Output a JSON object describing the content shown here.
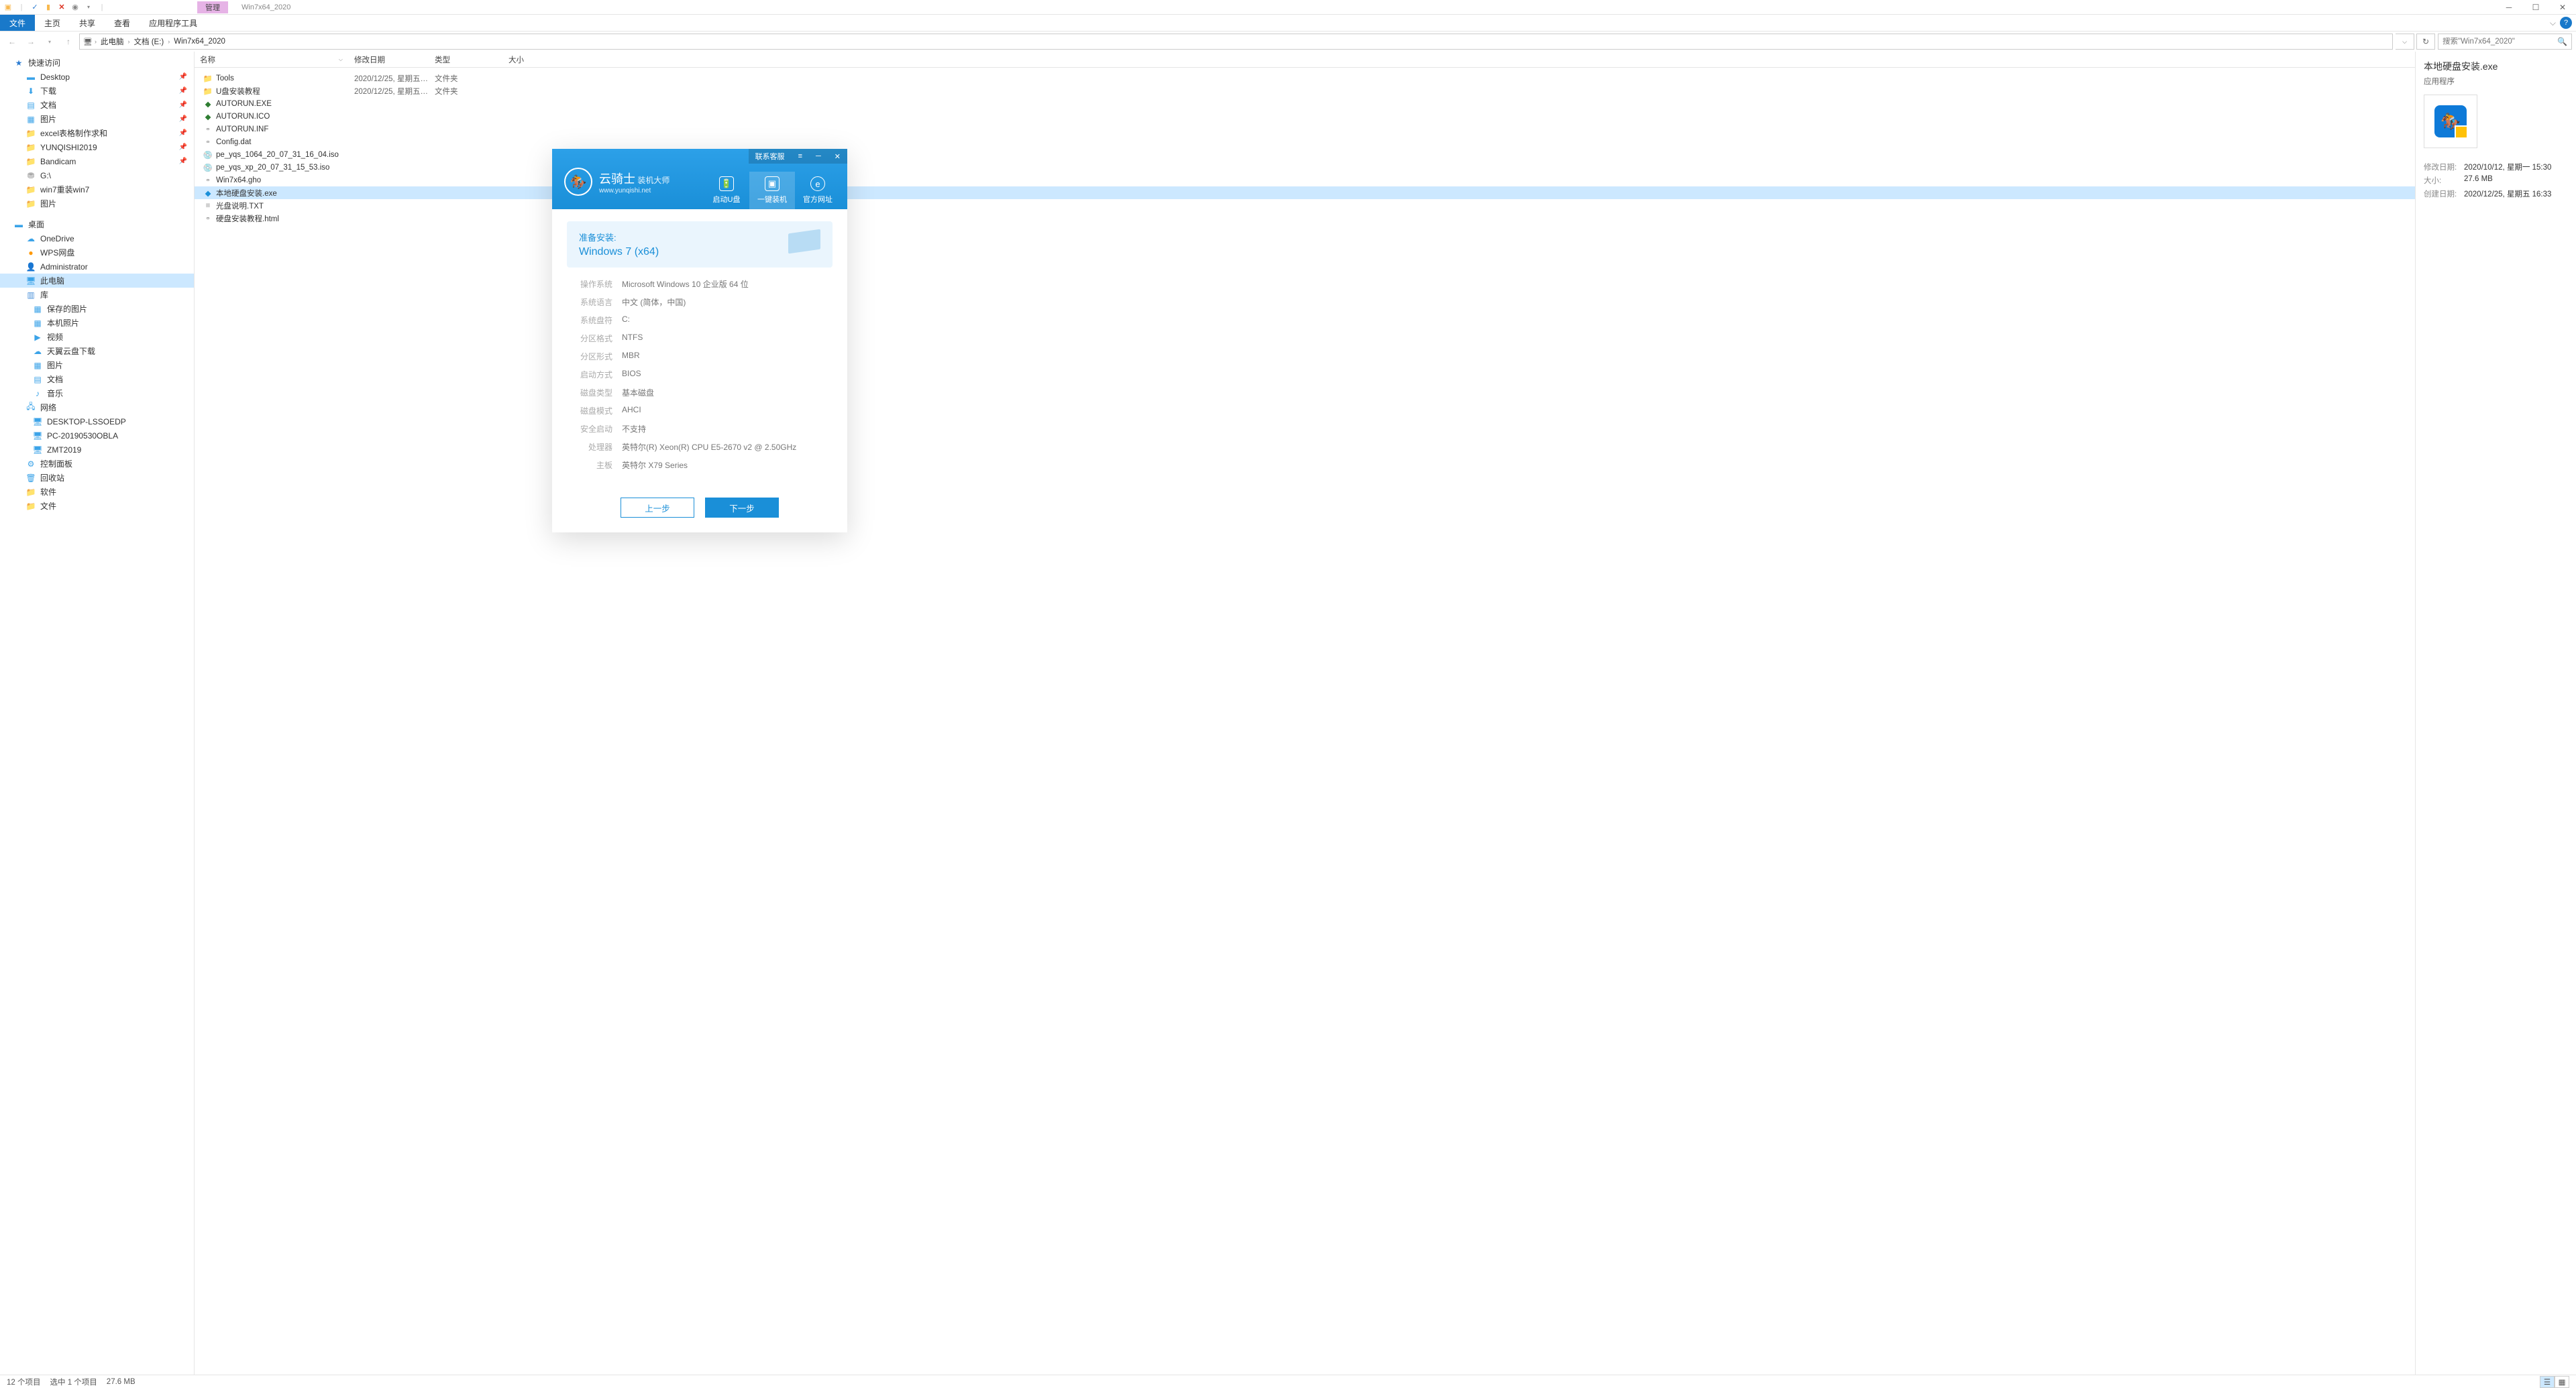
{
  "window": {
    "title": "Win7x64_2020",
    "manage_tab": "管理"
  },
  "ribbon": {
    "file": "文件",
    "home": "主页",
    "share": "共享",
    "view": "查看",
    "apptools": "应用程序工具"
  },
  "breadcrumb": {
    "c1": "此电脑",
    "c2": "文档 (E:)",
    "c3": "Win7x64_2020"
  },
  "search": {
    "placeholder": "搜索\"Win7x64_2020\""
  },
  "nav": {
    "quick": "快速访问",
    "desktop": "Desktop",
    "downloads": "下载",
    "docs": "文档",
    "pics": "图片",
    "excel": "excel表格制作求和",
    "yunqishi": "YUNQISHI2019",
    "bandicam": "Bandicam",
    "g": "G:\\",
    "win7re": "win7重装win7",
    "pics2": "图片",
    "deskhead": "桌面",
    "onedrive": "OneDrive",
    "wps": "WPS网盘",
    "admin": "Administrator",
    "thispc": "此电脑",
    "lib": "库",
    "savedpics": "保存的图片",
    "localphotos": "本机照片",
    "video": "视频",
    "tianyi": "天翼云盘下载",
    "pics3": "图片",
    "docs2": "文档",
    "music": "音乐",
    "network": "网络",
    "pc1": "DESKTOP-LSSOEDP",
    "pc2": "PC-20190530OBLA",
    "pc3": "ZMT2019",
    "ctrlpanel": "控制面板",
    "recycle": "回收站",
    "soft": "软件",
    "files": "文件"
  },
  "columns": {
    "name": "名称",
    "date": "修改日期",
    "type": "类型",
    "size": "大小"
  },
  "files": [
    {
      "name": "Tools",
      "date": "2020/12/25, 星期五 1...",
      "type": "文件夹",
      "icon": "folder"
    },
    {
      "name": "U盘安装教程",
      "date": "2020/12/25, 星期五 1...",
      "type": "文件夹",
      "icon": "folder"
    },
    {
      "name": "AUTORUN.EXE",
      "date": "",
      "type": "",
      "icon": "exe-green"
    },
    {
      "name": "AUTORUN.ICO",
      "date": "",
      "type": "",
      "icon": "exe-green"
    },
    {
      "name": "AUTORUN.INF",
      "date": "",
      "type": "",
      "icon": "file"
    },
    {
      "name": "Config.dat",
      "date": "",
      "type": "",
      "icon": "file"
    },
    {
      "name": "pe_yqs_1064_20_07_31_16_04.iso",
      "date": "",
      "type": "",
      "icon": "disc"
    },
    {
      "name": "pe_yqs_xp_20_07_31_15_53.iso",
      "date": "",
      "type": "",
      "icon": "disc"
    },
    {
      "name": "Win7x64.gho",
      "date": "",
      "type": "",
      "icon": "file"
    },
    {
      "name": "本地硬盘安装.exe",
      "date": "",
      "type": "",
      "icon": "exe-blue",
      "selected": true
    },
    {
      "name": "光盘说明.TXT",
      "date": "",
      "type": "",
      "icon": "txt"
    },
    {
      "name": "硬盘安装教程.html",
      "date": "",
      "type": "",
      "icon": "file"
    }
  ],
  "preview": {
    "title": "本地硬盘安装.exe",
    "subtitle": "应用程序",
    "m_date_l": "修改日期:",
    "m_date": "2020/10/12, 星期一 15:30",
    "size_l": "大小:",
    "size": "27.6 MB",
    "created_l": "创建日期:",
    "created": "2020/12/25, 星期五 16:33"
  },
  "status": {
    "count": "12 个项目",
    "sel": "选中 1 个项目",
    "size": "27.6 MB"
  },
  "dialog": {
    "contact": "联系客服",
    "brand": "云骑士",
    "brand_sub": "装机大师",
    "url": "www.yunqishi.net",
    "tab1": "启动U盘",
    "tab2": "一键装机",
    "tab3": "官方网址",
    "card_l1": "准备安装:",
    "card_l2": "Windows 7 (x64)",
    "info": [
      {
        "l": "操作系统",
        "v": "Microsoft Windows 10 企业版 64 位"
      },
      {
        "l": "系统语言",
        "v": "中文 (简体，中国)"
      },
      {
        "l": "系统盘符",
        "v": "C:"
      },
      {
        "l": "分区格式",
        "v": "NTFS"
      },
      {
        "l": "分区形式",
        "v": "MBR"
      },
      {
        "l": "启动方式",
        "v": "BIOS"
      },
      {
        "l": "磁盘类型",
        "v": "基本磁盘"
      },
      {
        "l": "磁盘模式",
        "v": "AHCI"
      },
      {
        "l": "安全启动",
        "v": "不支持"
      },
      {
        "l": "处理器",
        "v": "英特尔(R) Xeon(R) CPU E5-2670 v2 @ 2.50GHz"
      },
      {
        "l": "主板",
        "v": "英特尔 X79 Series"
      }
    ],
    "btn_prev": "上一步",
    "btn_next": "下一步"
  }
}
